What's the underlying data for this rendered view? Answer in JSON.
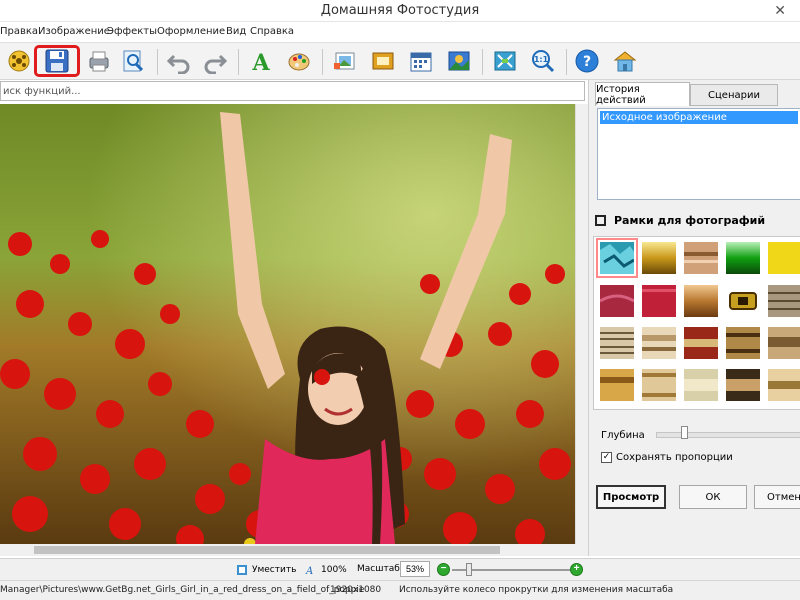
{
  "window": {
    "title": "Домашняя Фотостудия"
  },
  "menu": [
    "Правка",
    "Изображение",
    "Эффекты",
    "Оформление",
    "Вид",
    "Справка"
  ],
  "toolbar": {
    "buttons": [
      "open-icon",
      "save-icon",
      "print-icon",
      "zoom-preview-icon",
      "undo-icon",
      "redo-icon",
      "text-icon",
      "palette-icon",
      "image-insert-icon",
      "frame-icon",
      "calendar-icon",
      "collage-icon",
      "fit-icon",
      "zoom-1-1-icon",
      "help-icon",
      "home-icon"
    ],
    "highlight_color": "#e01b1b"
  },
  "search": {
    "placeholder": "иск функций..."
  },
  "right_panel": {
    "tabs": [
      "История действий",
      "Сценарии"
    ],
    "history_items": [
      "Исходное изображение"
    ],
    "frames_title": "Рамки для фотографий",
    "depth_label": "Глубина",
    "keep_proportions_label": "Сохранять пропорции",
    "keep_proportions_checked": true,
    "buttons": {
      "preview": "Просмотр",
      "ok": "ОК",
      "cancel": "Отмена"
    }
  },
  "bottom": {
    "fit_label": "Уместить",
    "zoom_100_label": "100%",
    "scale_label": "Масштаб:",
    "scale_value": "53%",
    "scale_slider_fraction": 0.12
  },
  "status": {
    "path": "Manager\\Pictures\\www.GetBg.net_Girls_Girl_in_a_red_dress_on_a_field_of_poppie",
    "dimensions": "1920x1080",
    "hint": "Используйте колесо прокрутки для изменения масштаба"
  }
}
